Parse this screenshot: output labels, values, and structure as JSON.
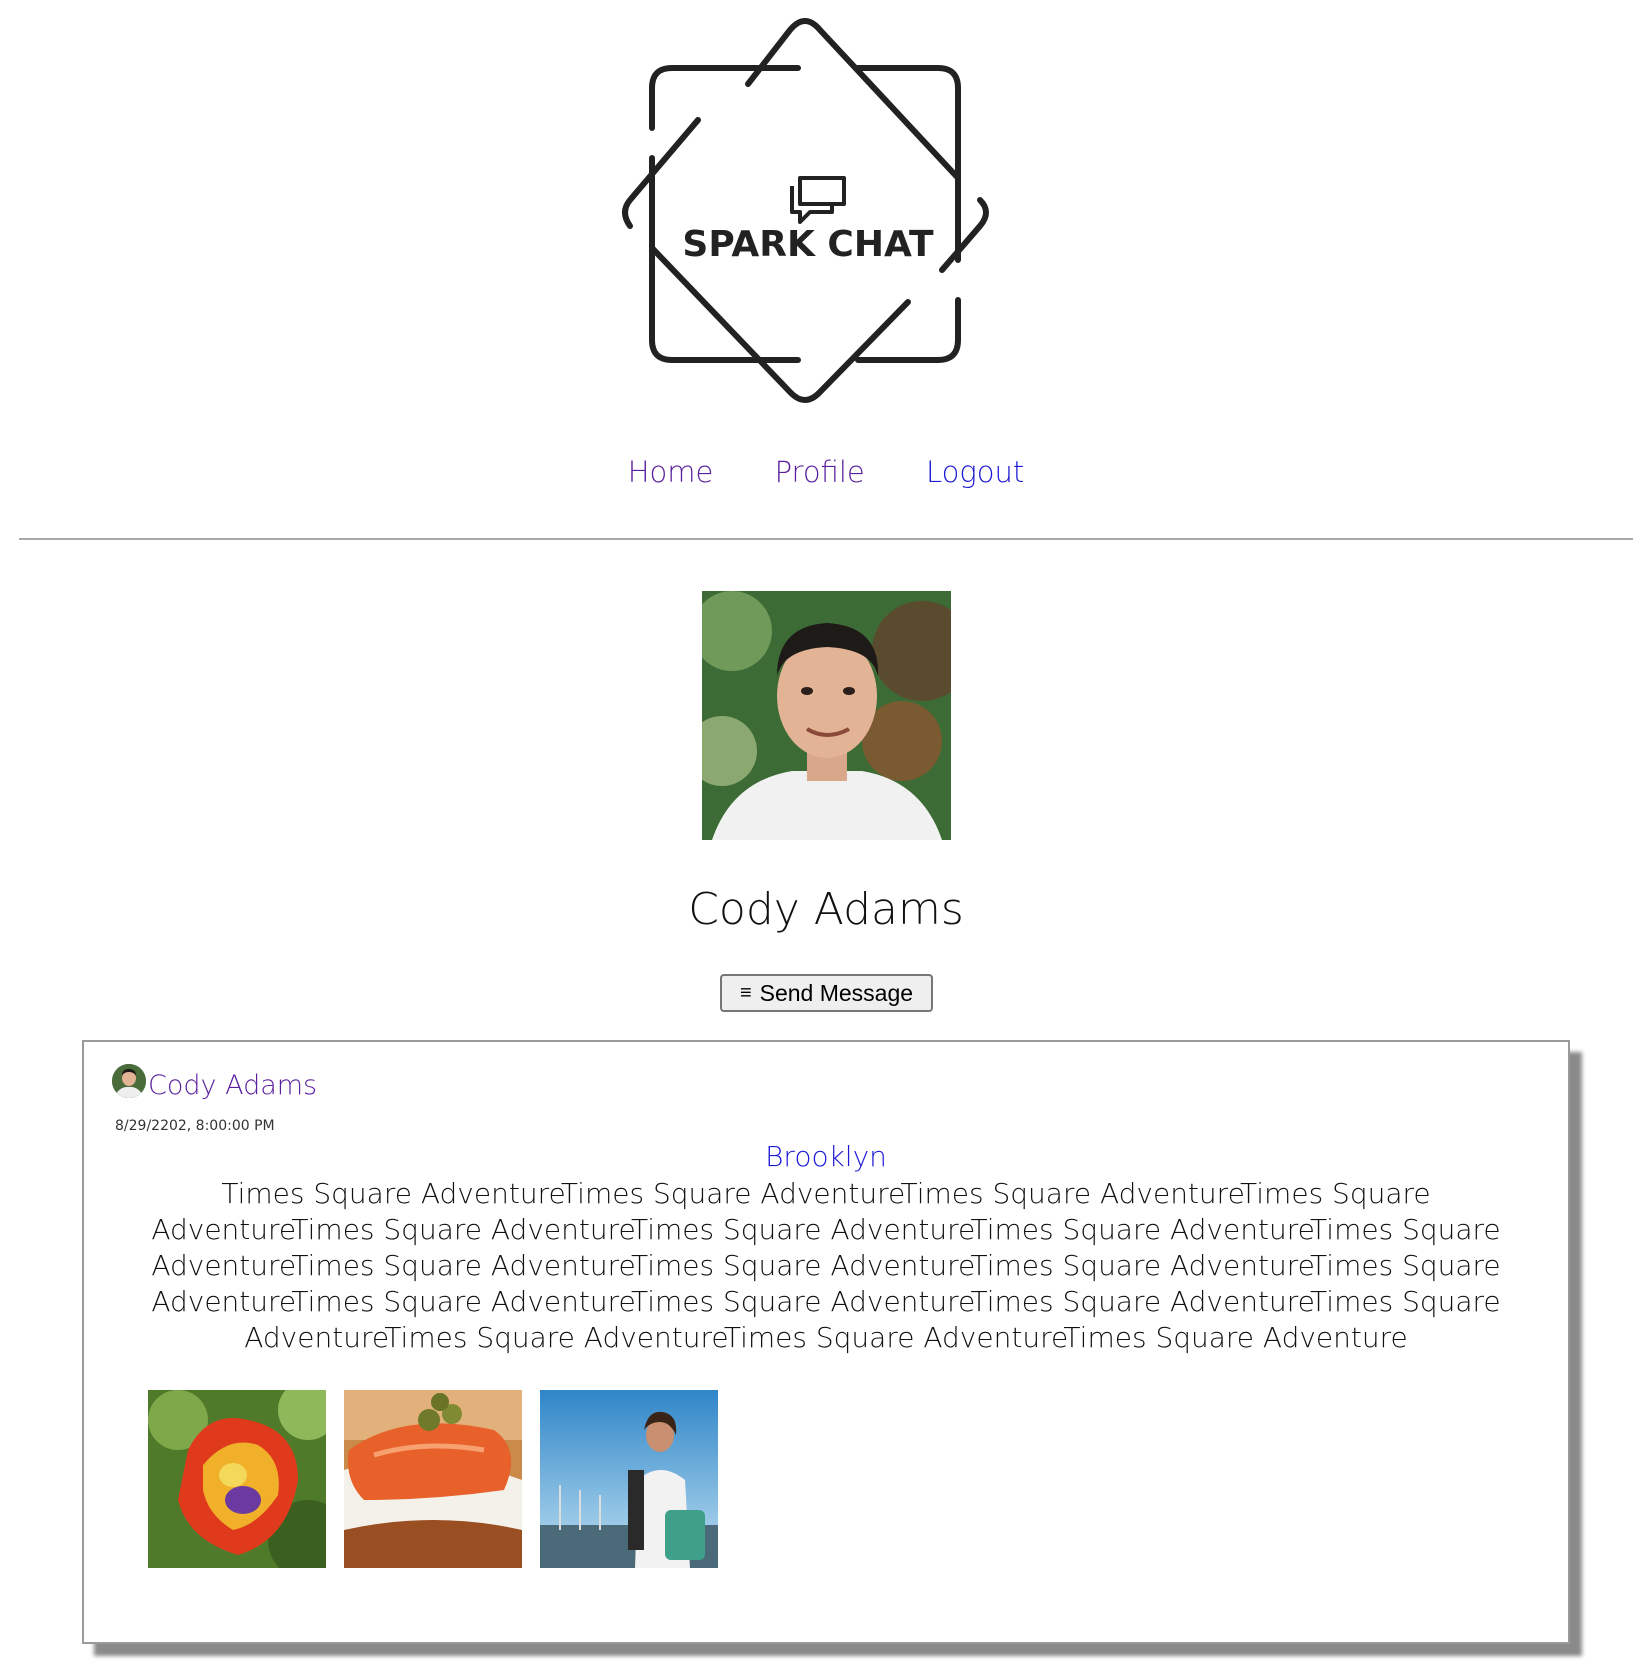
{
  "logo": {
    "text": "SPARK CHAT",
    "icon": "chat-bubbles-icon"
  },
  "nav": {
    "home": "Home",
    "profile": "Profile",
    "logout": "Logout"
  },
  "profile": {
    "name": "Cody Adams",
    "photo": "profile-photo",
    "send_button_icon": "menu-icon",
    "send_button_label": "Send Message"
  },
  "post": {
    "author": "Cody Adams",
    "date": "8/29/2202, 8:00:00 PM",
    "location": "Brooklyn",
    "body": "Times Square AdventureTimes Square AdventureTimes Square AdventureTimes Square AdventureTimes Square AdventureTimes Square AdventureTimes Square AdventureTimes Square AdventureTimes Square AdventureTimes Square AdventureTimes Square AdventureTimes Square AdventureTimes Square AdventureTimes Square AdventureTimes Square AdventureTimes Square AdventureTimes Square AdventureTimes Square AdventureTimes Square Adventure",
    "images": [
      {
        "alt": "flower photo"
      },
      {
        "alt": "salmon toast photo"
      },
      {
        "alt": "person at harbor photo"
      }
    ]
  },
  "colors": {
    "nav_visited": "#5a1f9e",
    "nav_link": "#1d1ad6",
    "card_shadow": "#8a8a8a"
  }
}
